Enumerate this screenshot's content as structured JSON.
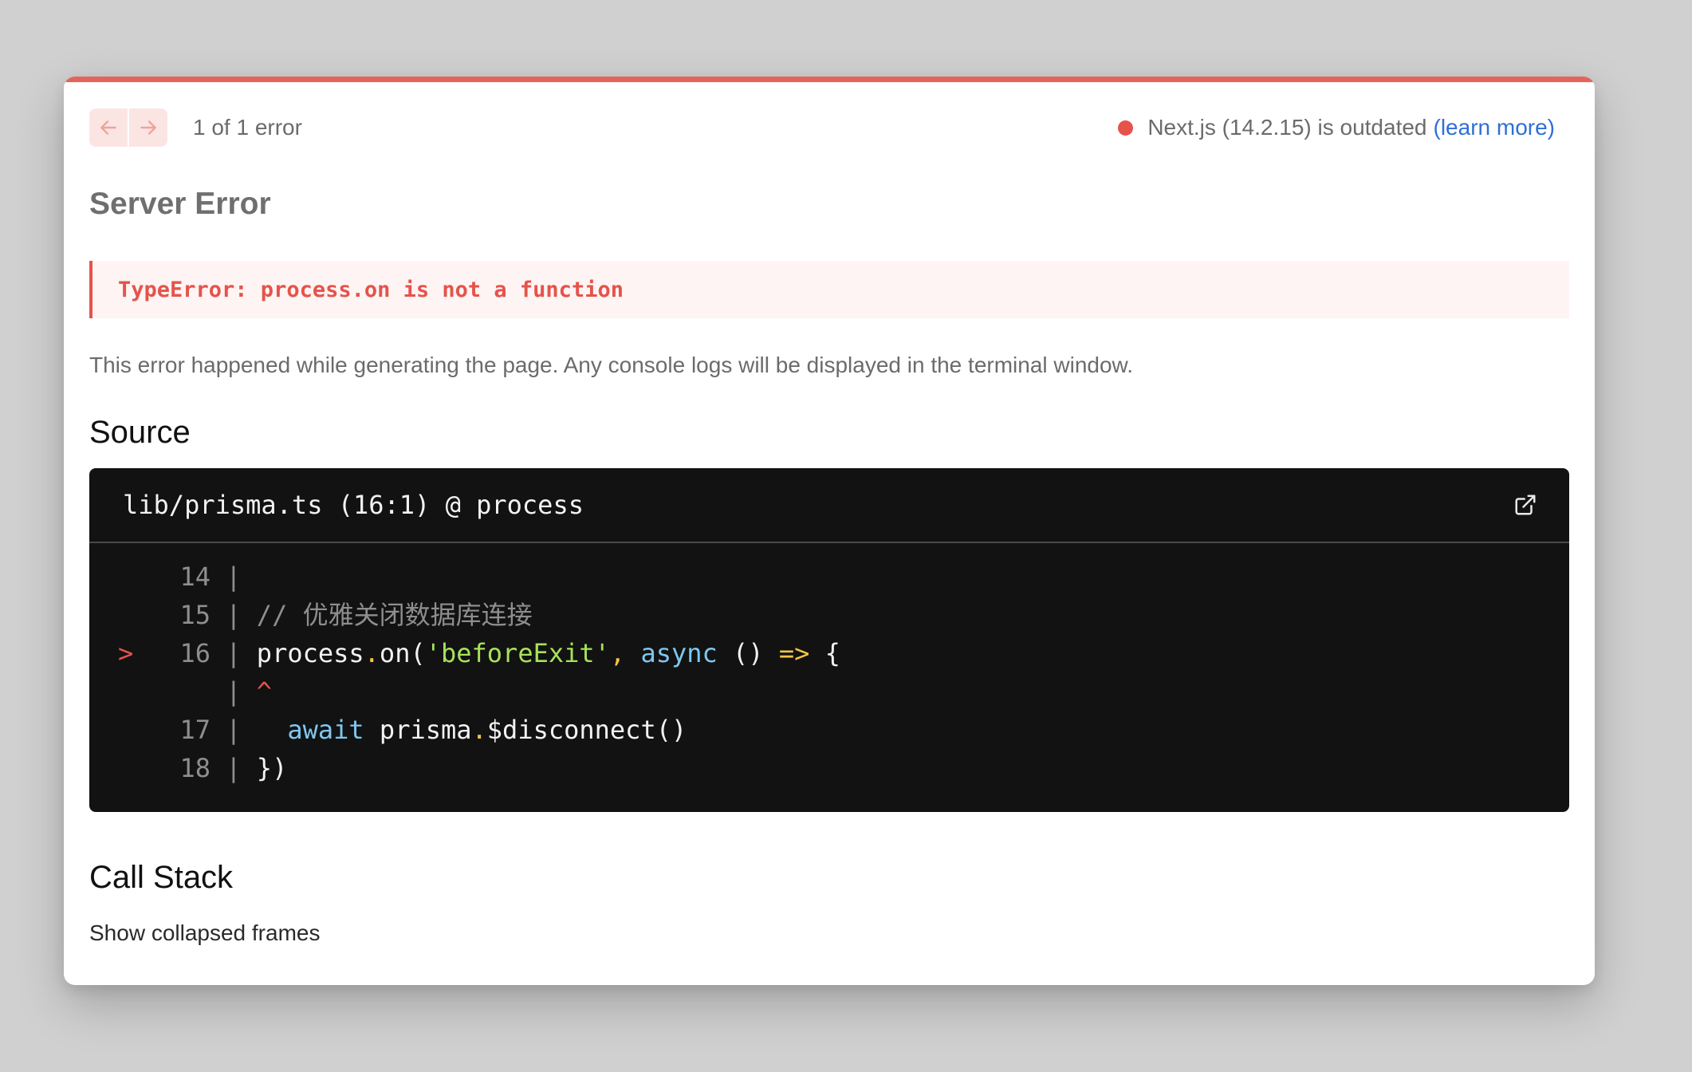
{
  "colors": {
    "accent_error": "#e5534b",
    "link": "#2f6fd8",
    "code_background": "#121212"
  },
  "nav": {
    "prev_icon": "arrow-left-icon",
    "next_icon": "arrow-right-icon",
    "counter": "1 of 1 error"
  },
  "version": {
    "status_icon": "status-dot-icon",
    "text": "Next.js (14.2.15) is outdated",
    "link_label": "(learn more)"
  },
  "error": {
    "title": "Server Error",
    "message": "TypeError: process.on is not a function",
    "description": "This error happened while generating the page. Any console logs will be displayed in the terminal window."
  },
  "source": {
    "heading": "Source",
    "file_location": "lib/prisma.ts (16:1) @ process",
    "open_icon": "external-link-icon",
    "lines": [
      {
        "marker": "",
        "number": "14",
        "sep": " | ",
        "tokens": []
      },
      {
        "marker": "",
        "number": "15",
        "sep": " | ",
        "tokens": [
          {
            "cls": "tok-comment",
            "text": "// 优雅关闭数据库连接"
          }
        ]
      },
      {
        "marker": ">",
        "number": "16",
        "sep": " | ",
        "tokens": [
          {
            "cls": "tok-plain",
            "text": "process"
          },
          {
            "cls": "tok-punct",
            "text": "."
          },
          {
            "cls": "tok-plain",
            "text": "on("
          },
          {
            "cls": "tok-string",
            "text": "'beforeExit'"
          },
          {
            "cls": "tok-punct",
            "text": ","
          },
          {
            "cls": "tok-plain",
            "text": " "
          },
          {
            "cls": "tok-keyword",
            "text": "async"
          },
          {
            "cls": "tok-plain",
            "text": " () "
          },
          {
            "cls": "tok-arrow",
            "text": "=>"
          },
          {
            "cls": "tok-plain",
            "text": " {"
          }
        ]
      },
      {
        "marker": "",
        "number": "",
        "sep": " | ",
        "tokens": [
          {
            "cls": "tok-caret",
            "text": "^"
          }
        ]
      },
      {
        "marker": "",
        "number": "17",
        "sep": " | ",
        "tokens": [
          {
            "cls": "tok-plain",
            "text": "  "
          },
          {
            "cls": "tok-keyword",
            "text": "await"
          },
          {
            "cls": "tok-plain",
            "text": " prisma"
          },
          {
            "cls": "tok-punct",
            "text": "."
          },
          {
            "cls": "tok-plain",
            "text": "$disconnect()"
          }
        ]
      },
      {
        "marker": "",
        "number": "18",
        "sep": " | ",
        "tokens": [
          {
            "cls": "tok-plain",
            "text": "})"
          }
        ]
      }
    ]
  },
  "call_stack": {
    "heading": "Call Stack",
    "toggle_label": "Show collapsed frames"
  }
}
